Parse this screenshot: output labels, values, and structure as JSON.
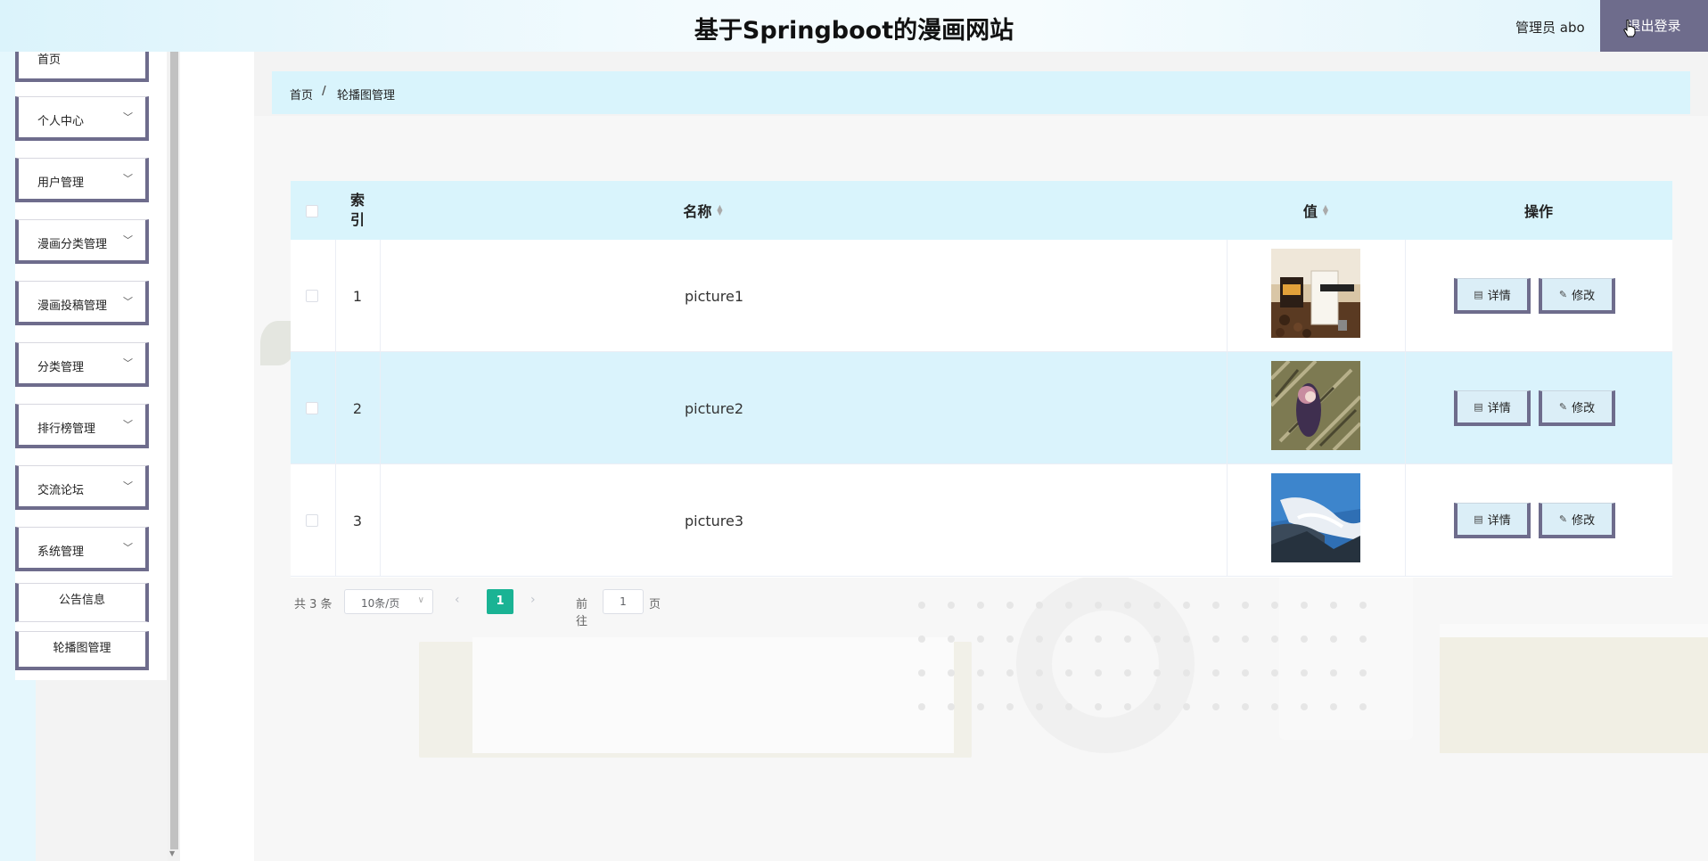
{
  "header": {
    "title": "基于Springboot的漫画网站",
    "admin_label": "管理员 abo",
    "logout_label": "退出登录"
  },
  "sidebar": {
    "items": [
      {
        "label": "首页",
        "has_children": false
      },
      {
        "label": "个人中心",
        "has_children": true
      },
      {
        "label": "用户管理",
        "has_children": true
      },
      {
        "label": "漫画分类管理",
        "has_children": true
      },
      {
        "label": "漫画投稿管理",
        "has_children": true
      },
      {
        "label": "分类管理",
        "has_children": true
      },
      {
        "label": "排行榜管理",
        "has_children": true
      },
      {
        "label": "交流论坛",
        "has_children": true
      },
      {
        "label": "系统管理",
        "has_children": true
      }
    ],
    "sub_items": [
      {
        "label": "公告信息"
      },
      {
        "label": "轮播图管理"
      }
    ]
  },
  "breadcrumb": {
    "home": "首页",
    "separator": "/",
    "current": "轮播图管理"
  },
  "table": {
    "columns": {
      "index": "索引",
      "name": "名称",
      "value": "值",
      "ops": "操作"
    },
    "rows": [
      {
        "index": "1",
        "name": "picture1",
        "image": "coffee-photo"
      },
      {
        "index": "2",
        "name": "picture2",
        "image": "anime-girl-photo"
      },
      {
        "index": "3",
        "name": "picture3",
        "image": "sky-mountain-photo"
      }
    ],
    "detail_label": "详情",
    "edit_label": "修改"
  },
  "pagination": {
    "total": "共 3 条",
    "page_size": "10条/页",
    "current_page": "1",
    "goto_label": "前往",
    "goto_value": "1",
    "page_unit": "页"
  },
  "colors": {
    "accent": "#6e6c8c",
    "header_bg": "#dbf3fb",
    "row_highlight": "#daf3fc",
    "pager_active": "#1ab394"
  }
}
